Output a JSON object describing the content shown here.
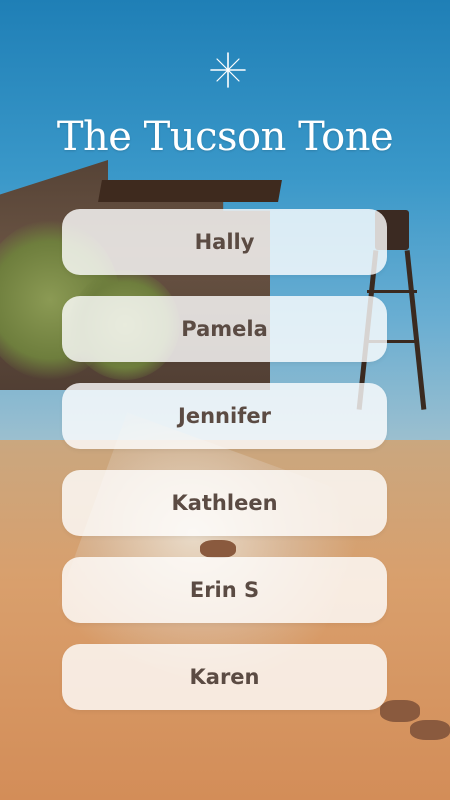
{
  "app": {
    "title": "The Tucson Tone"
  },
  "links": [
    {
      "label": "Hally"
    },
    {
      "label": "Pamela"
    },
    {
      "label": "Jennifer"
    },
    {
      "label": "Kathleen"
    },
    {
      "label": "Erin S"
    },
    {
      "label": "Karen"
    }
  ],
  "colors": {
    "button_text": "#5b4b43",
    "title_text": "#ffffff",
    "button_bg": "rgba(255,255,255,0.80)"
  },
  "icons": {
    "top": "sparkle-icon"
  }
}
